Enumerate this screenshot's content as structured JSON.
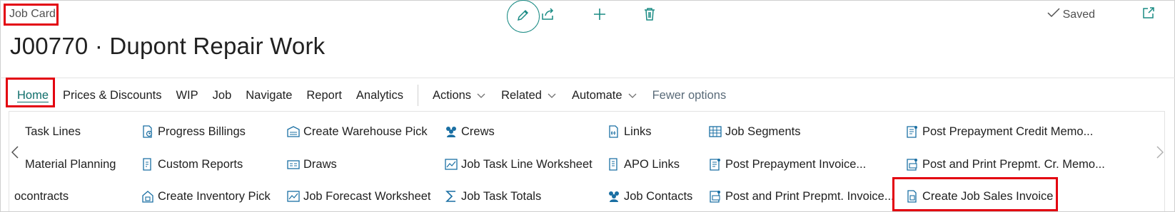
{
  "header": {
    "caption": "Job Card",
    "saved_label": "Saved",
    "title": "J00770 · Dupont Repair Work"
  },
  "tabs": [
    "Home",
    "Prices & Discounts",
    "WIP",
    "Job",
    "Navigate",
    "Report",
    "Analytics"
  ],
  "menus": [
    "Actions",
    "Related",
    "Automate"
  ],
  "fewer_options": "Fewer options",
  "actions": {
    "col1": [
      "Task Lines",
      "Material Planning",
      "ocontracts"
    ],
    "col2": [
      "Progress Billings",
      "Custom Reports",
      "Create Inventory Pick"
    ],
    "col3": [
      "Create Warehouse Pick",
      "Draws",
      "Job Forecast Worksheet"
    ],
    "col4": [
      "Crews",
      "Job Task Line Worksheet",
      "Job Task Totals"
    ],
    "col5": [
      "Links",
      "APO Links",
      "Job Contacts"
    ],
    "col6": [
      "Job Segments",
      "Post Prepayment Invoice...",
      "Post and Print Prepmt. Invoice..."
    ],
    "col7": [
      "Post Prepayment Credit Memo...",
      "Post and Print Prepmt. Cr. Memo...",
      "Create Job Sales Invoice"
    ]
  },
  "colors": {
    "accent": "#1a8b84",
    "highlight": "#e3000f"
  }
}
